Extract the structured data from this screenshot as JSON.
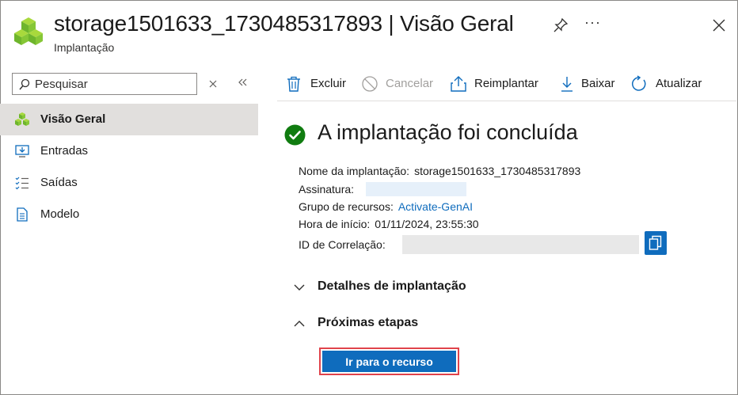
{
  "header": {
    "title": "storage1501633_1730485317893 | Visão Geral",
    "subtitle": "Implantação",
    "more_label": "···"
  },
  "sidebar": {
    "search_placeholder": "Pesquisar",
    "items": [
      {
        "label": "Visão Geral",
        "icon": "cubes-icon",
        "active": true
      },
      {
        "label": "Entradas",
        "icon": "monitor-download-icon",
        "active": false
      },
      {
        "label": "Saídas",
        "icon": "checklist-icon",
        "active": false
      },
      {
        "label": "Modelo",
        "icon": "document-icon",
        "active": false
      }
    ]
  },
  "toolbar": {
    "delete_label": "Excluir",
    "cancel_label": "Cancelar",
    "redeploy_label": "Reimplantar",
    "download_label": "Baixar",
    "refresh_label": "Atualizar"
  },
  "main": {
    "heading": "A implantação foi concluída",
    "deployment_name_label": "Nome da implantação:",
    "deployment_name_value": "storage1501633_1730485317893",
    "subscription_label": "Assinatura:",
    "resource_group_label": "Grupo de recursos:",
    "resource_group_value": "Activate-GenAI",
    "start_time_label": "Hora de início:",
    "start_time_value": "01/11/2024, 23:55:30",
    "correlation_label": "ID de Correlação:",
    "details_section": "Detalhes de implantação",
    "next_steps_section": "Próximas etapas",
    "go_to_resource_button": "Ir para o recurso"
  },
  "colors": {
    "accent": "#0f6cbd",
    "success": "#107c10",
    "highlight_border": "#e0434b"
  }
}
